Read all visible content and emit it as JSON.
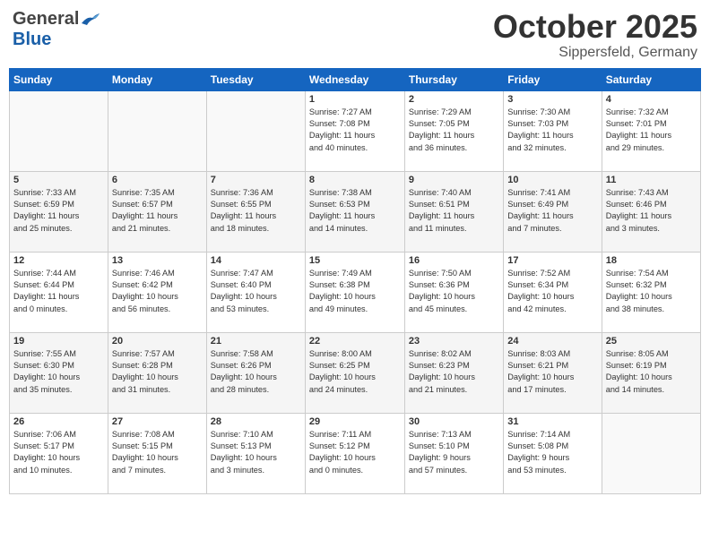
{
  "header": {
    "logo_general": "General",
    "logo_blue": "Blue",
    "month_title": "October 2025",
    "location": "Sippersfeld, Germany"
  },
  "weekdays": [
    "Sunday",
    "Monday",
    "Tuesday",
    "Wednesday",
    "Thursday",
    "Friday",
    "Saturday"
  ],
  "weeks": [
    [
      {
        "day": "",
        "info": ""
      },
      {
        "day": "",
        "info": ""
      },
      {
        "day": "",
        "info": ""
      },
      {
        "day": "1",
        "info": "Sunrise: 7:27 AM\nSunset: 7:08 PM\nDaylight: 11 hours\nand 40 minutes."
      },
      {
        "day": "2",
        "info": "Sunrise: 7:29 AM\nSunset: 7:05 PM\nDaylight: 11 hours\nand 36 minutes."
      },
      {
        "day": "3",
        "info": "Sunrise: 7:30 AM\nSunset: 7:03 PM\nDaylight: 11 hours\nand 32 minutes."
      },
      {
        "day": "4",
        "info": "Sunrise: 7:32 AM\nSunset: 7:01 PM\nDaylight: 11 hours\nand 29 minutes."
      }
    ],
    [
      {
        "day": "5",
        "info": "Sunrise: 7:33 AM\nSunset: 6:59 PM\nDaylight: 11 hours\nand 25 minutes."
      },
      {
        "day": "6",
        "info": "Sunrise: 7:35 AM\nSunset: 6:57 PM\nDaylight: 11 hours\nand 21 minutes."
      },
      {
        "day": "7",
        "info": "Sunrise: 7:36 AM\nSunset: 6:55 PM\nDaylight: 11 hours\nand 18 minutes."
      },
      {
        "day": "8",
        "info": "Sunrise: 7:38 AM\nSunset: 6:53 PM\nDaylight: 11 hours\nand 14 minutes."
      },
      {
        "day": "9",
        "info": "Sunrise: 7:40 AM\nSunset: 6:51 PM\nDaylight: 11 hours\nand 11 minutes."
      },
      {
        "day": "10",
        "info": "Sunrise: 7:41 AM\nSunset: 6:49 PM\nDaylight: 11 hours\nand 7 minutes."
      },
      {
        "day": "11",
        "info": "Sunrise: 7:43 AM\nSunset: 6:46 PM\nDaylight: 11 hours\nand 3 minutes."
      }
    ],
    [
      {
        "day": "12",
        "info": "Sunrise: 7:44 AM\nSunset: 6:44 PM\nDaylight: 11 hours\nand 0 minutes."
      },
      {
        "day": "13",
        "info": "Sunrise: 7:46 AM\nSunset: 6:42 PM\nDaylight: 10 hours\nand 56 minutes."
      },
      {
        "day": "14",
        "info": "Sunrise: 7:47 AM\nSunset: 6:40 PM\nDaylight: 10 hours\nand 53 minutes."
      },
      {
        "day": "15",
        "info": "Sunrise: 7:49 AM\nSunset: 6:38 PM\nDaylight: 10 hours\nand 49 minutes."
      },
      {
        "day": "16",
        "info": "Sunrise: 7:50 AM\nSunset: 6:36 PM\nDaylight: 10 hours\nand 45 minutes."
      },
      {
        "day": "17",
        "info": "Sunrise: 7:52 AM\nSunset: 6:34 PM\nDaylight: 10 hours\nand 42 minutes."
      },
      {
        "day": "18",
        "info": "Sunrise: 7:54 AM\nSunset: 6:32 PM\nDaylight: 10 hours\nand 38 minutes."
      }
    ],
    [
      {
        "day": "19",
        "info": "Sunrise: 7:55 AM\nSunset: 6:30 PM\nDaylight: 10 hours\nand 35 minutes."
      },
      {
        "day": "20",
        "info": "Sunrise: 7:57 AM\nSunset: 6:28 PM\nDaylight: 10 hours\nand 31 minutes."
      },
      {
        "day": "21",
        "info": "Sunrise: 7:58 AM\nSunset: 6:26 PM\nDaylight: 10 hours\nand 28 minutes."
      },
      {
        "day": "22",
        "info": "Sunrise: 8:00 AM\nSunset: 6:25 PM\nDaylight: 10 hours\nand 24 minutes."
      },
      {
        "day": "23",
        "info": "Sunrise: 8:02 AM\nSunset: 6:23 PM\nDaylight: 10 hours\nand 21 minutes."
      },
      {
        "day": "24",
        "info": "Sunrise: 8:03 AM\nSunset: 6:21 PM\nDaylight: 10 hours\nand 17 minutes."
      },
      {
        "day": "25",
        "info": "Sunrise: 8:05 AM\nSunset: 6:19 PM\nDaylight: 10 hours\nand 14 minutes."
      }
    ],
    [
      {
        "day": "26",
        "info": "Sunrise: 7:06 AM\nSunset: 5:17 PM\nDaylight: 10 hours\nand 10 minutes."
      },
      {
        "day": "27",
        "info": "Sunrise: 7:08 AM\nSunset: 5:15 PM\nDaylight: 10 hours\nand 7 minutes."
      },
      {
        "day": "28",
        "info": "Sunrise: 7:10 AM\nSunset: 5:13 PM\nDaylight: 10 hours\nand 3 minutes."
      },
      {
        "day": "29",
        "info": "Sunrise: 7:11 AM\nSunset: 5:12 PM\nDaylight: 10 hours\nand 0 minutes."
      },
      {
        "day": "30",
        "info": "Sunrise: 7:13 AM\nSunset: 5:10 PM\nDaylight: 9 hours\nand 57 minutes."
      },
      {
        "day": "31",
        "info": "Sunrise: 7:14 AM\nSunset: 5:08 PM\nDaylight: 9 hours\nand 53 minutes."
      },
      {
        "day": "",
        "info": ""
      }
    ]
  ]
}
